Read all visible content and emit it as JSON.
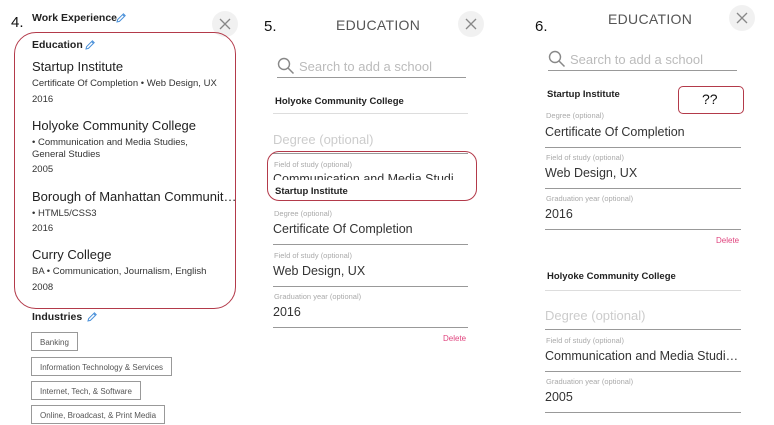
{
  "panel4": {
    "step": "4.",
    "work_experience_title": "Work Experience",
    "education_title": "Education",
    "education_items": [
      {
        "name": "Startup Institute",
        "detail": "Certificate Of Completion • Web Design, UX",
        "year": "2016"
      },
      {
        "name": "Holyoke Community College",
        "detail": "• Communication and Media Studies, General Studies",
        "year": "2005"
      },
      {
        "name": "Borough of Manhattan Communit…",
        "detail": "• HTML5/CSS3",
        "year": "2016"
      },
      {
        "name": "Curry College",
        "detail": "BA • Communication, Journalism, English",
        "year": "2008"
      }
    ],
    "industries_title": "Industries",
    "industries": [
      "Banking",
      "Information Technology & Services",
      "Internet, Tech, & Software",
      "Online, Broadcast, & Print Media"
    ]
  },
  "panel5": {
    "step": "5.",
    "title": "EDUCATION",
    "search_placeholder": "Search to add a school",
    "school1": "Holyoke Community College",
    "degree_placeholder": "Degree (optional)",
    "field_label": "Field of study (optional)",
    "field_value_cut": "Communication and Media Studi",
    "school2": "Startup Institute",
    "degree_label": "Degree (optional)",
    "degree_value": "Certificate Of Completion",
    "field2_label": "Field of study (optional)",
    "field2_value": "Web Design, UX",
    "year_label": "Graduation year (optional)",
    "year_value": "2016",
    "delete": "Delete"
  },
  "panel6": {
    "step": "6.",
    "title": "EDUCATION",
    "search_placeholder": "Search to add a school",
    "school1": "Startup Institute",
    "annotation": "??",
    "degree_label": "Degree (optional)",
    "degree_value": "Certificate Of Completion",
    "field_label": "Field of study (optional)",
    "field_value": "Web Design, UX",
    "year_label": "Graduation year (optional)",
    "year_value": "2016",
    "delete": "Delete",
    "school2": "Holyoke Community College",
    "degree_placeholder": "Degree (optional)",
    "field2_label": "Field of study (optional)",
    "field2_value": "Communication and Media Studi…",
    "year2_label": "Graduation year (optional)",
    "year2_value": "2005"
  },
  "colors": {
    "annotation_red": "#b33a4a",
    "delete_pink": "#e0447e"
  },
  "icons": [
    "pencil-icon",
    "close-icon",
    "search-icon"
  ]
}
